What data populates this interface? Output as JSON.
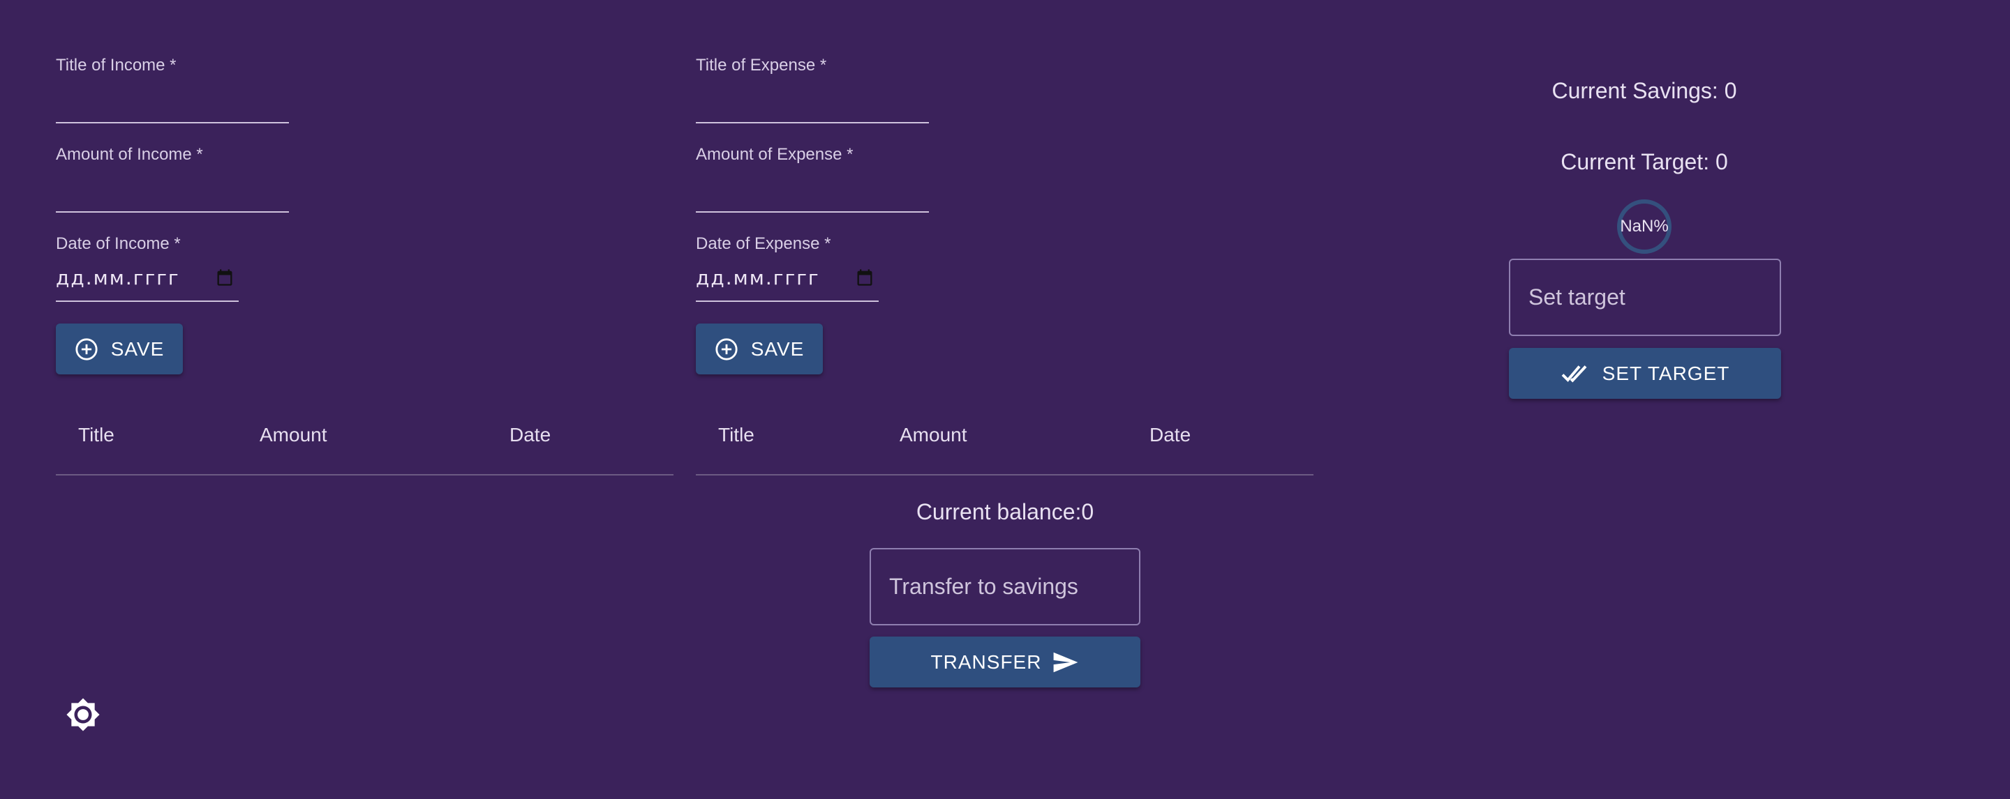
{
  "income": {
    "title_label": "Title of Income *",
    "amount_label": "Amount of Income *",
    "date_label": "Date of Income *",
    "date_placeholder": "дд.мм.гггг",
    "save_label": "SAVE"
  },
  "expense": {
    "title_label": "Title of Expense *",
    "amount_label": "Amount of Expense *",
    "date_label": "Date of Expense *",
    "date_placeholder": "дд.мм.гггг",
    "save_label": "SAVE"
  },
  "income_table": {
    "headers": [
      "Title",
      "Amount",
      "Date"
    ]
  },
  "expense_table": {
    "headers": [
      "Title",
      "Amount",
      "Date"
    ]
  },
  "balance": {
    "text": "Current balance:0",
    "transfer_placeholder": "Transfer to savings",
    "transfer_label": "TRANSFER"
  },
  "savings": {
    "current_savings": "Current Savings: 0",
    "current_target": "Current Target: 0",
    "progress_text": "NaN%",
    "target_placeholder": "Set target",
    "set_target_label": "SET TARGET"
  },
  "icons": {
    "add": "add-circle-icon",
    "calendar": "calendar-icon",
    "check": "double-check-icon",
    "send": "send-icon",
    "theme": "brightness-icon"
  },
  "colors": {
    "background": "#3b225b",
    "button": "#2f4f7f"
  }
}
